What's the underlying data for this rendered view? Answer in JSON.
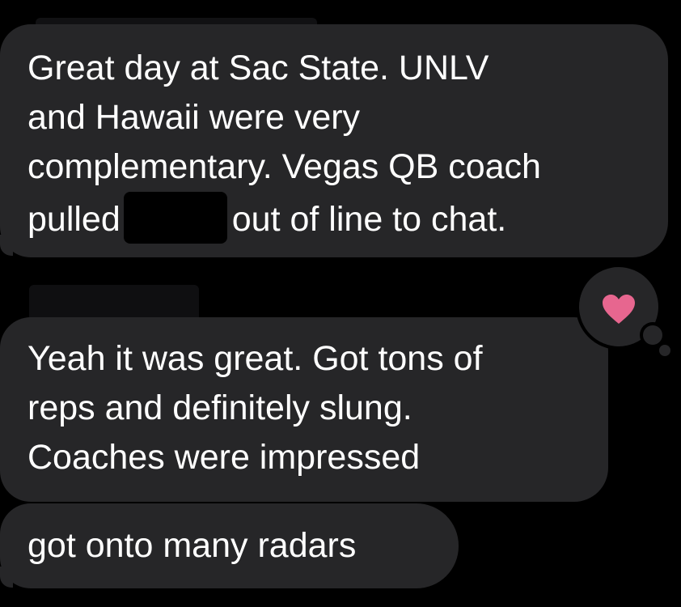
{
  "conversation": {
    "messages": [
      {
        "lines": [
          "Great day at Sac State. UNLV",
          "and Hawaii were very",
          "complementary. Vegas QB coach",
          "pulled",
          "out of line to chat."
        ]
      },
      {
        "lines": [
          "Yeah it was great. Got tons of",
          "reps and definitely slung.",
          "Coaches were impressed"
        ],
        "reaction": {
          "icon": "heart-icon",
          "color": "#e7668f"
        }
      },
      {
        "lines": [
          "got onto many radars"
        ]
      }
    ]
  },
  "colors": {
    "background": "#000000",
    "bubble": "#262628",
    "text": "#ffffff"
  }
}
